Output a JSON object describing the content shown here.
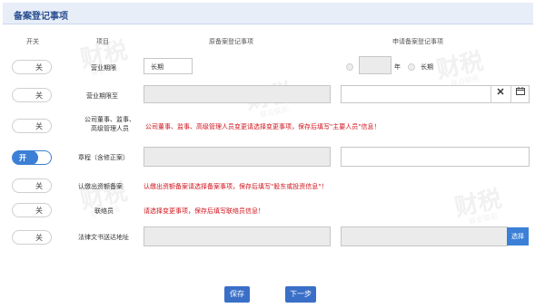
{
  "section": {
    "title": "备案登记事项"
  },
  "headers": {
    "col_switch": "开关",
    "col_item": "项目",
    "col_original": "原备案登记事项",
    "col_apply": "申请备案登记事项"
  },
  "rows": [
    {
      "switch": "关",
      "item": "营业期限",
      "original_value": "长期",
      "year_unit": "年",
      "long_term_label": "长期"
    },
    {
      "switch": "关",
      "item": "营业期限至"
    },
    {
      "switch": "关",
      "item_line1": "公司董事、监事、",
      "item_line2": "高级管理人员",
      "note": "公司董事、监事、高级管理人员变更请选择变更事项，保存后填写\"主要人员\"信息！"
    },
    {
      "switch": "开",
      "item": "章程（含修正案）"
    },
    {
      "switch": "关",
      "item": "认缴出资额备案",
      "note": "认缴出资额备案请选择备案事项，保存后填写\"股东或投资信息\"！"
    },
    {
      "switch": "关",
      "item": "联络员",
      "note": "请选择变更事项，保存后填写联络员信息！"
    },
    {
      "switch": "关",
      "item": "法律文书送达地址",
      "select_label": "选择"
    }
  ],
  "icons": {
    "clear": "close-icon",
    "calendar": "calendar-icon"
  },
  "actions": {
    "save_label": "保存",
    "next_label": "下一步"
  },
  "watermark": {
    "text": "财税",
    "sub": "联合联拓"
  }
}
